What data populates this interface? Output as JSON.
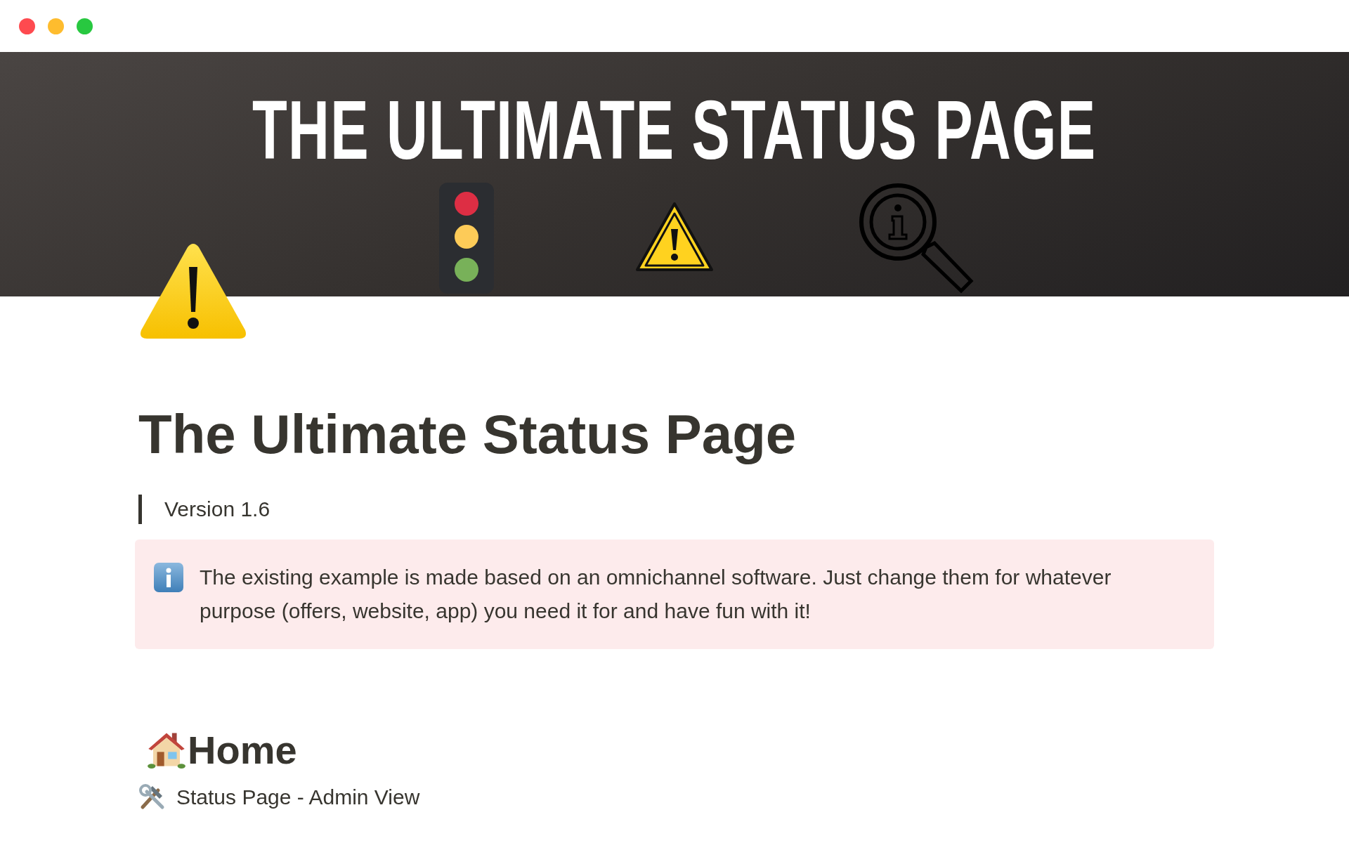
{
  "banner": {
    "title": "THE ULTIMATE STATUS PAGE"
  },
  "page": {
    "title": "The Ultimate Status Page",
    "quote": "Version 1.6",
    "callout": {
      "text": "The existing example is made based on an omnichannel software. Just change them for whatever purpose (offers, website, app) you need it for and have fun with it!"
    },
    "sections": [
      {
        "heading": "Home",
        "items": [
          {
            "label": "Status Page - Admin View"
          }
        ]
      }
    ]
  }
}
